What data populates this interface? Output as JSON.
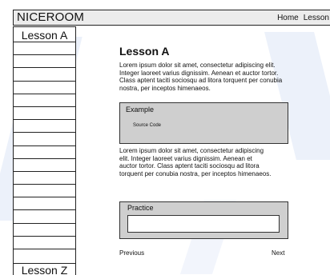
{
  "header": {
    "logo": "NICEROOM",
    "nav": [
      "Home",
      "Lesson"
    ]
  },
  "sidebar": {
    "top_label": "Lesson A",
    "bottom_label": "Lesson Z",
    "slot_count": 16
  },
  "main": {
    "title": "Lesson A",
    "paragraph1": "Lorem ipsum dolor sit amet, consectetur  adipiscing elit. Integer laoreet varius  dignissim. Aenean et auctor tortor.  Class aptent taciti sociosqu ad litora torquent per conubia nostra, per inceptos himenaeos.",
    "example": {
      "label": "Example",
      "code": "Source Code"
    },
    "paragraph2": "Lorem ipsum dolor sit amet, consectetur adipiscing elit. Integer laoreet varius dignissim. Aenean et auctor tortor. Class aptent taciti sociosqu ad litora torquent per conubia nostra, per inceptos himenaeos.",
    "practice": {
      "label": "Practice",
      "input_value": ""
    },
    "prev_label": "Previous",
    "next_label": "Next"
  },
  "colors": {
    "header_bg": "#ececec",
    "box_bg": "#cfcfcf",
    "bg_shape": "#dfe7f7"
  }
}
